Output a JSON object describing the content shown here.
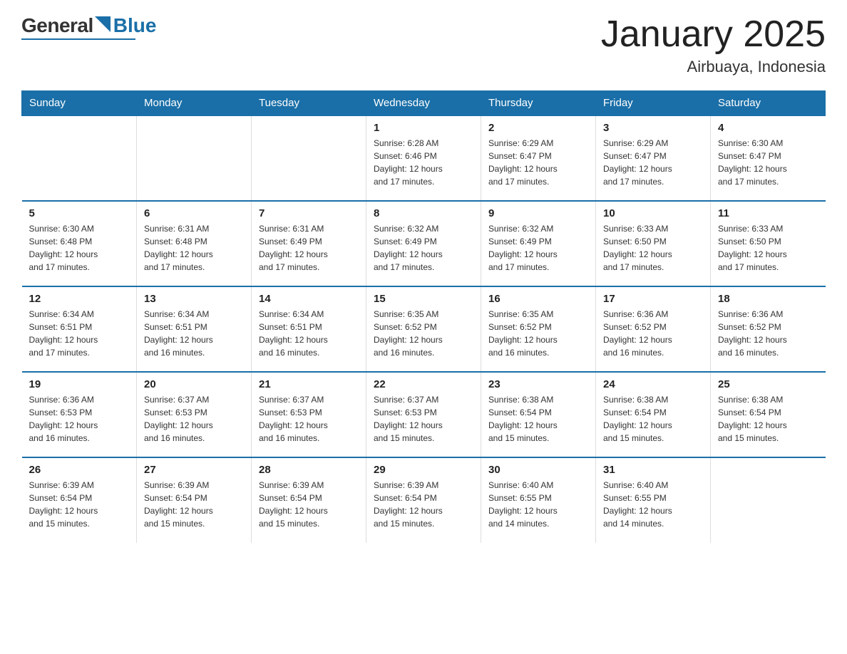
{
  "logo": {
    "general": "General",
    "blue": "Blue",
    "triangle": "▶"
  },
  "header": {
    "month": "January 2025",
    "location": "Airbuaya, Indonesia"
  },
  "days_of_week": [
    "Sunday",
    "Monday",
    "Tuesday",
    "Wednesday",
    "Thursday",
    "Friday",
    "Saturday"
  ],
  "weeks": [
    [
      {
        "day": "",
        "info": ""
      },
      {
        "day": "",
        "info": ""
      },
      {
        "day": "",
        "info": ""
      },
      {
        "day": "1",
        "info": "Sunrise: 6:28 AM\nSunset: 6:46 PM\nDaylight: 12 hours\nand 17 minutes."
      },
      {
        "day": "2",
        "info": "Sunrise: 6:29 AM\nSunset: 6:47 PM\nDaylight: 12 hours\nand 17 minutes."
      },
      {
        "day": "3",
        "info": "Sunrise: 6:29 AM\nSunset: 6:47 PM\nDaylight: 12 hours\nand 17 minutes."
      },
      {
        "day": "4",
        "info": "Sunrise: 6:30 AM\nSunset: 6:47 PM\nDaylight: 12 hours\nand 17 minutes."
      }
    ],
    [
      {
        "day": "5",
        "info": "Sunrise: 6:30 AM\nSunset: 6:48 PM\nDaylight: 12 hours\nand 17 minutes."
      },
      {
        "day": "6",
        "info": "Sunrise: 6:31 AM\nSunset: 6:48 PM\nDaylight: 12 hours\nand 17 minutes."
      },
      {
        "day": "7",
        "info": "Sunrise: 6:31 AM\nSunset: 6:49 PM\nDaylight: 12 hours\nand 17 minutes."
      },
      {
        "day": "8",
        "info": "Sunrise: 6:32 AM\nSunset: 6:49 PM\nDaylight: 12 hours\nand 17 minutes."
      },
      {
        "day": "9",
        "info": "Sunrise: 6:32 AM\nSunset: 6:49 PM\nDaylight: 12 hours\nand 17 minutes."
      },
      {
        "day": "10",
        "info": "Sunrise: 6:33 AM\nSunset: 6:50 PM\nDaylight: 12 hours\nand 17 minutes."
      },
      {
        "day": "11",
        "info": "Sunrise: 6:33 AM\nSunset: 6:50 PM\nDaylight: 12 hours\nand 17 minutes."
      }
    ],
    [
      {
        "day": "12",
        "info": "Sunrise: 6:34 AM\nSunset: 6:51 PM\nDaylight: 12 hours\nand 17 minutes."
      },
      {
        "day": "13",
        "info": "Sunrise: 6:34 AM\nSunset: 6:51 PM\nDaylight: 12 hours\nand 16 minutes."
      },
      {
        "day": "14",
        "info": "Sunrise: 6:34 AM\nSunset: 6:51 PM\nDaylight: 12 hours\nand 16 minutes."
      },
      {
        "day": "15",
        "info": "Sunrise: 6:35 AM\nSunset: 6:52 PM\nDaylight: 12 hours\nand 16 minutes."
      },
      {
        "day": "16",
        "info": "Sunrise: 6:35 AM\nSunset: 6:52 PM\nDaylight: 12 hours\nand 16 minutes."
      },
      {
        "day": "17",
        "info": "Sunrise: 6:36 AM\nSunset: 6:52 PM\nDaylight: 12 hours\nand 16 minutes."
      },
      {
        "day": "18",
        "info": "Sunrise: 6:36 AM\nSunset: 6:52 PM\nDaylight: 12 hours\nand 16 minutes."
      }
    ],
    [
      {
        "day": "19",
        "info": "Sunrise: 6:36 AM\nSunset: 6:53 PM\nDaylight: 12 hours\nand 16 minutes."
      },
      {
        "day": "20",
        "info": "Sunrise: 6:37 AM\nSunset: 6:53 PM\nDaylight: 12 hours\nand 16 minutes."
      },
      {
        "day": "21",
        "info": "Sunrise: 6:37 AM\nSunset: 6:53 PM\nDaylight: 12 hours\nand 16 minutes."
      },
      {
        "day": "22",
        "info": "Sunrise: 6:37 AM\nSunset: 6:53 PM\nDaylight: 12 hours\nand 15 minutes."
      },
      {
        "day": "23",
        "info": "Sunrise: 6:38 AM\nSunset: 6:54 PM\nDaylight: 12 hours\nand 15 minutes."
      },
      {
        "day": "24",
        "info": "Sunrise: 6:38 AM\nSunset: 6:54 PM\nDaylight: 12 hours\nand 15 minutes."
      },
      {
        "day": "25",
        "info": "Sunrise: 6:38 AM\nSunset: 6:54 PM\nDaylight: 12 hours\nand 15 minutes."
      }
    ],
    [
      {
        "day": "26",
        "info": "Sunrise: 6:39 AM\nSunset: 6:54 PM\nDaylight: 12 hours\nand 15 minutes."
      },
      {
        "day": "27",
        "info": "Sunrise: 6:39 AM\nSunset: 6:54 PM\nDaylight: 12 hours\nand 15 minutes."
      },
      {
        "day": "28",
        "info": "Sunrise: 6:39 AM\nSunset: 6:54 PM\nDaylight: 12 hours\nand 15 minutes."
      },
      {
        "day": "29",
        "info": "Sunrise: 6:39 AM\nSunset: 6:54 PM\nDaylight: 12 hours\nand 15 minutes."
      },
      {
        "day": "30",
        "info": "Sunrise: 6:40 AM\nSunset: 6:55 PM\nDaylight: 12 hours\nand 14 minutes."
      },
      {
        "day": "31",
        "info": "Sunrise: 6:40 AM\nSunset: 6:55 PM\nDaylight: 12 hours\nand 14 minutes."
      },
      {
        "day": "",
        "info": ""
      }
    ]
  ]
}
